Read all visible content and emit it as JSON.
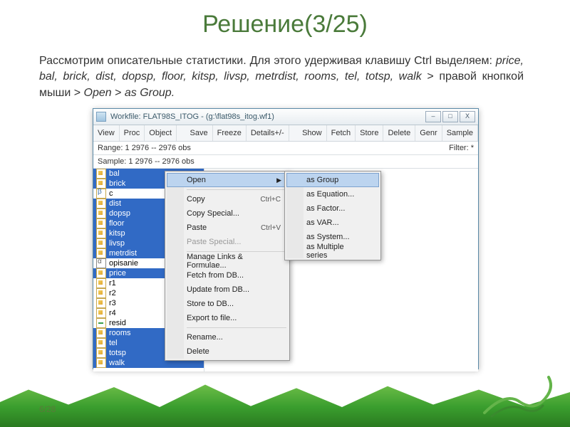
{
  "slide": {
    "title": "Решение(3/25)",
    "body_pre": "Рассмотрим описательные статистики. Для этого удерживая клавишу Ctrl выделяем: ",
    "body_italic": "price, bal, brick, dist, dopsp, floor, kitsp, livsp, metrdist, rooms, tel, totsp, walk",
    "body_mid": " > правой кнопкой мыши > ",
    "body_open": "Open",
    "body_gt": " > ",
    "body_group": "as Group.",
    "footer": "6/28"
  },
  "window": {
    "title": "Workfile: FLAT98S_ITOG - (g:\\flat98s_itog.wf1)",
    "toolbar": [
      "View",
      "Proc",
      "Object",
      "Save",
      "Freeze",
      "Details+/-",
      "Show",
      "Fetch",
      "Store",
      "Delete",
      "Genr",
      "Sample"
    ],
    "range_label": "Range:  1 2976   --  2976 obs",
    "filter_label": "Filter: *",
    "sample_label": "Sample: 1 2976   --  2976 obs",
    "vars": [
      {
        "n": "bal",
        "sel": true,
        "i": "y"
      },
      {
        "n": "brick",
        "sel": true,
        "i": "y"
      },
      {
        "n": "c",
        "sel": false,
        "i": "b"
      },
      {
        "n": "dist",
        "sel": true,
        "i": "y"
      },
      {
        "n": "dopsp",
        "sel": true,
        "i": "y"
      },
      {
        "n": "floor",
        "sel": true,
        "i": "y"
      },
      {
        "n": "kitsp",
        "sel": true,
        "i": "y"
      },
      {
        "n": "livsp",
        "sel": true,
        "i": "y"
      },
      {
        "n": "metrdist",
        "sel": true,
        "i": "y"
      },
      {
        "n": "opisanie",
        "sel": false,
        "i": "a"
      },
      {
        "n": "price",
        "sel": true,
        "i": "y"
      },
      {
        "n": "r1",
        "sel": false,
        "i": "y"
      },
      {
        "n": "r2",
        "sel": false,
        "i": "y"
      },
      {
        "n": "r3",
        "sel": false,
        "i": "y"
      },
      {
        "n": "r4",
        "sel": false,
        "i": "y"
      },
      {
        "n": "resid",
        "sel": false,
        "i": "g"
      },
      {
        "n": "rooms",
        "sel": true,
        "i": "y"
      },
      {
        "n": "tel",
        "sel": true,
        "i": "y"
      },
      {
        "n": "totsp",
        "sel": true,
        "i": "y"
      },
      {
        "n": "walk",
        "sel": true,
        "i": "y"
      }
    ],
    "winbtns": {
      "min": "–",
      "max": "□",
      "close": "X"
    }
  },
  "menu": {
    "items": [
      {
        "label": "Open",
        "type": "hl",
        "arrow": true
      },
      {
        "type": "sep"
      },
      {
        "label": "Copy",
        "sc": "Ctrl+C"
      },
      {
        "label": "Copy Special..."
      },
      {
        "label": "Paste",
        "sc": "Ctrl+V"
      },
      {
        "label": "Paste Special...",
        "dis": true
      },
      {
        "type": "sep"
      },
      {
        "label": "Manage Links & Formulae..."
      },
      {
        "label": "Fetch from DB..."
      },
      {
        "label": "Update from DB..."
      },
      {
        "label": "Store to DB..."
      },
      {
        "label": "Export to file..."
      },
      {
        "type": "sep"
      },
      {
        "label": "Rename..."
      },
      {
        "label": "Delete"
      }
    ]
  },
  "submenu": {
    "items": [
      {
        "label": "as Group",
        "hl": true
      },
      {
        "label": "as Equation..."
      },
      {
        "label": "as Factor..."
      },
      {
        "label": "as VAR..."
      },
      {
        "label": "as System..."
      },
      {
        "label": "as Multiple series"
      }
    ]
  }
}
